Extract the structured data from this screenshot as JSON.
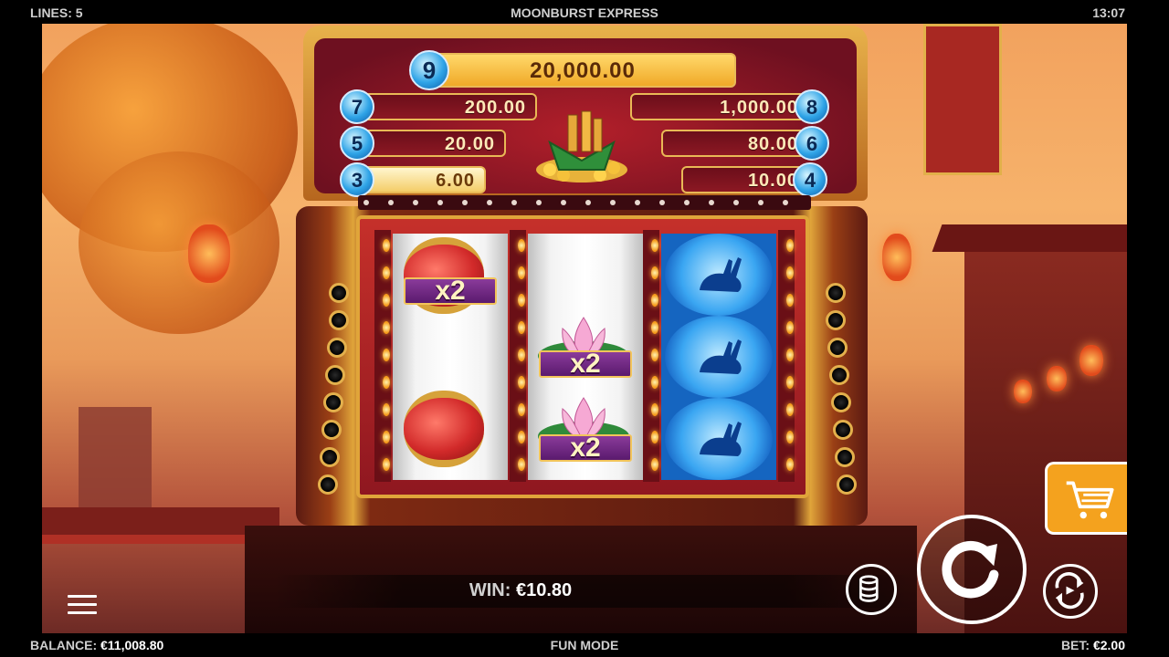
{
  "top_bar": {
    "lines_label": "LINES: 5",
    "title": "MOONBURST EXPRESS",
    "clock": "13:07"
  },
  "bottom_bar": {
    "balance_label": "BALANCE:",
    "balance_value": "€11,008.80",
    "mode": "FUN MODE",
    "bet_label": "BET:",
    "bet_value": "€2.00"
  },
  "paytable": {
    "top": {
      "count": "9",
      "amount": "20,000.00"
    },
    "left": [
      {
        "count": "7",
        "amount": "200.00"
      },
      {
        "count": "5",
        "amount": "20.00"
      },
      {
        "count": "3",
        "amount": "6.00"
      }
    ],
    "right": [
      {
        "count": "8",
        "amount": "1,000.00"
      },
      {
        "count": "6",
        "amount": "80.00"
      },
      {
        "count": "4",
        "amount": "10.00"
      }
    ]
  },
  "reels": {
    "reel1": {
      "symbols": [
        "lantern",
        "lantern"
      ],
      "multiplier": "x2"
    },
    "reel2": {
      "symbols": [
        "lotus",
        "lotus"
      ],
      "multipliers": [
        "x2",
        "x2"
      ]
    },
    "reel3": {
      "symbols": [
        "moon-rabbit",
        "moon-rabbit",
        "moon-rabbit"
      ]
    }
  },
  "win": {
    "label": "WIN:",
    "value": "€10.80"
  },
  "controls": {
    "menu_icon": "hamburger-icon",
    "bet_icon": "coin-stack-icon",
    "spin_icon": "spin-arrow-icon",
    "autoplay_icon": "autoplay-icon",
    "shop_icon": "shopping-cart-icon"
  },
  "colors": {
    "accent_gold": "#e9b956",
    "panel_red": "#8c1823",
    "gem_blue": "#2fa4e7",
    "cart_orange": "#f4a21e"
  }
}
